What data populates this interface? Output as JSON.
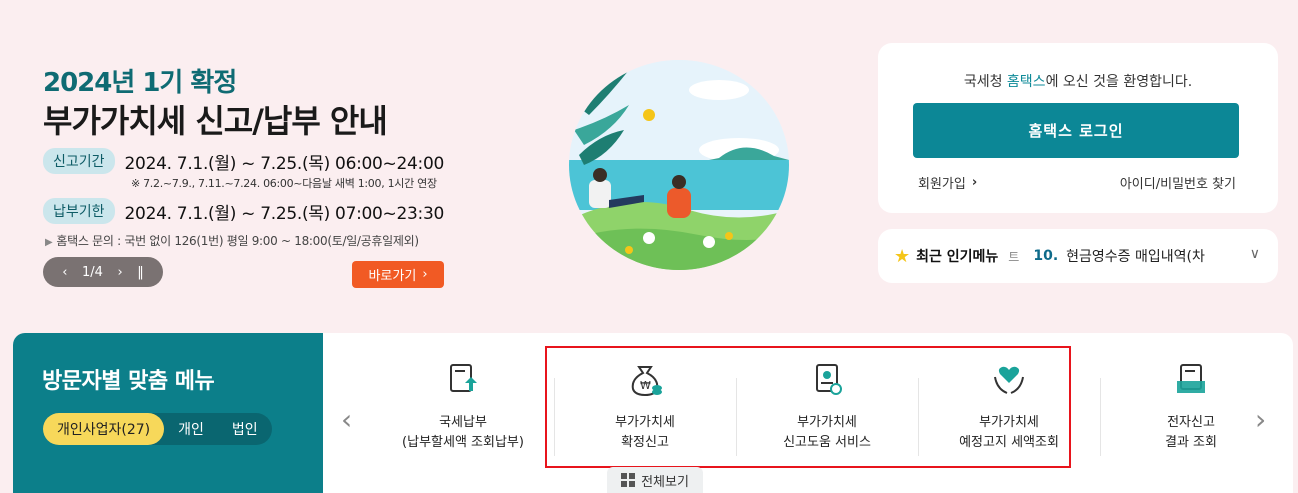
{
  "banner": {
    "subtitle": "2024년 1기 확정",
    "title": "부가가치세 신고/납부 안내",
    "filing_label": "신고기간",
    "filing_period": "2024. 7.1.(월) ~ 7.25.(목) 06:00~24:00",
    "filing_note": "※ 7.2.~7.9., 7.11.~7.24. 06:00~다음날 새벽 1:00, 1시간 연장",
    "payment_label": "납부기한",
    "payment_period": "2024. 7.1.(월) ~ 7.25.(목) 07:00~23:30",
    "inquiry": "홈택스 문의 : 국번 없이 126(1번) 평일 9:00 ~ 18:00(토/일/공휴일제외)",
    "pager": "1/4",
    "go_button": "바로가기"
  },
  "login": {
    "welcome_prefix": "국세청 ",
    "welcome_brand": "홈택스",
    "welcome_suffix": "에 오신 것을 환영합니다.",
    "login_button": "홈택스 로그인",
    "join": "회원가입",
    "find_id": "아이디/비밀번호 찾기"
  },
  "popular": {
    "title": "최근 인기메뉴",
    "cut_text": "트",
    "num": "10.",
    "item": "현금영수증 매입내역(차"
  },
  "custom_menu": {
    "title": "방문자별 맞춤 메뉴",
    "segments": [
      "개인사업자(27)",
      "개인",
      "법인"
    ],
    "items": [
      {
        "line1": "국세납부",
        "line2": "(납부할세액 조회납부)"
      },
      {
        "line1": "부가가치세",
        "line2": "확정신고"
      },
      {
        "line1": "부가가치세",
        "line2": "신고도움 서비스"
      },
      {
        "line1": "부가가치세",
        "line2": "예정고지 세액조회"
      },
      {
        "line1": "전자신고",
        "line2": "결과 조회"
      }
    ],
    "view_all": "전체보기"
  },
  "colors": {
    "teal": "#0c7f8a",
    "accent_orange": "#f15a24",
    "highlight_red": "#e8141c",
    "segment_active": "#f7d85a"
  }
}
